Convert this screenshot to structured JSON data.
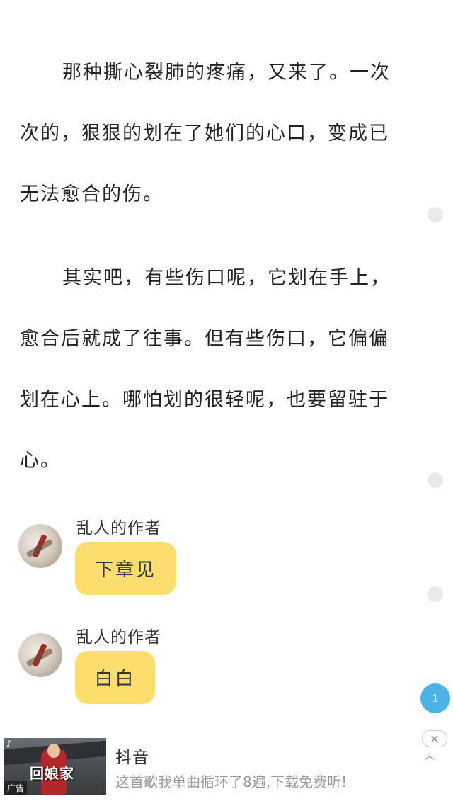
{
  "article": {
    "paragraphs": [
      "那种撕心裂肺的疼痛，又来了。一次次的，狠狠的划在了她们的心口，变成已无法愈合的伤。",
      "其实吧，有些伤口呢，它划在手上，愈合后就成了往事。但有些伤口，它偏偏划在心上。哪怕划的很轻呢，也要留驻于心。"
    ]
  },
  "messages": [
    {
      "author": "乱人的作者",
      "text": "下章见"
    },
    {
      "author": "乱人的作者",
      "text": "白白"
    }
  ],
  "page_badge": "1",
  "ad": {
    "title": "抖音",
    "description": "这首歌我单曲循环了8遍,下载免费听!",
    "image_text": "回娘家",
    "tag": "广告",
    "close_icon": "✕",
    "collapse_icon": "︿"
  },
  "colors": {
    "bubble": "#fddd6e",
    "badge": "#4db3e6"
  }
}
